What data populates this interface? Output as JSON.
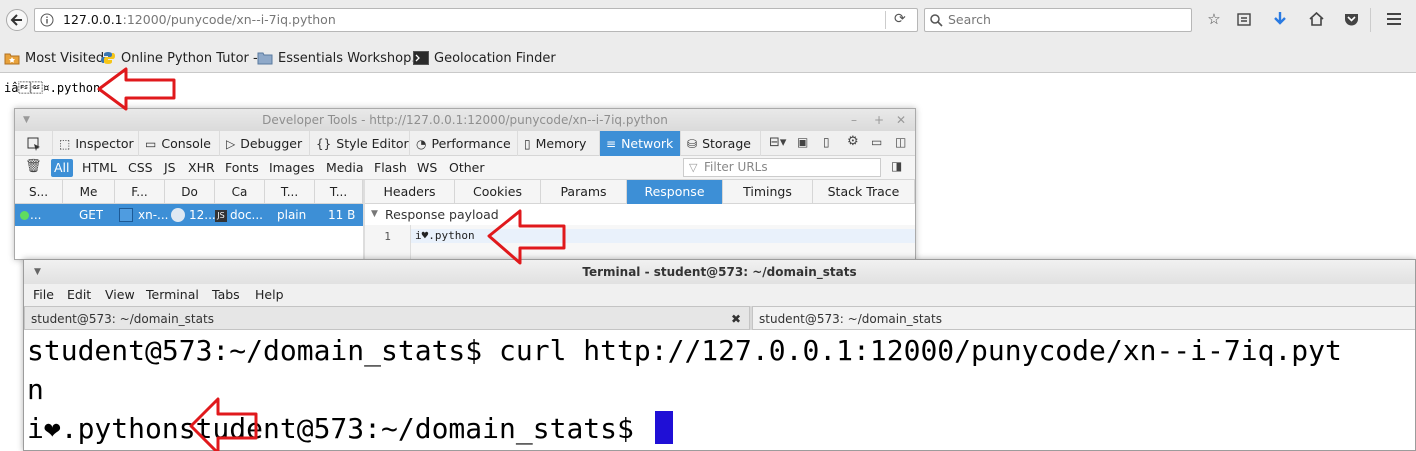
{
  "browser": {
    "url": "127.0.0.1:12000/punycode/xn--i-7iq.python",
    "url_host": "127.0.0.1",
    "url_rest": ":12000/punycode/xn--i-7iq.python",
    "search_placeholder": "Search",
    "bookmarks": [
      {
        "label": "Most Visited",
        "icon": "star-folder-icon"
      },
      {
        "label": "Online Python Tutor -...",
        "icon": "python-icon"
      },
      {
        "label": "Essentials Workshop...",
        "icon": "folder-icon"
      },
      {
        "label": "Geolocation Finder",
        "icon": "terminal-icon"
      }
    ],
    "page_text": "iâ\u001c\u001d¤.python"
  },
  "devtools": {
    "title": "Developer Tools - http://127.0.0.1:12000/punycode/xn--i-7iq.python",
    "tabs": [
      {
        "label": "Inspector",
        "icon": "inspector-icon"
      },
      {
        "label": "Console",
        "icon": "console-icon"
      },
      {
        "label": "Debugger",
        "icon": "debugger-icon"
      },
      {
        "label": "Style Editor",
        "icon": "style-editor-icon"
      },
      {
        "label": "Performance",
        "icon": "performance-icon"
      },
      {
        "label": "Memory",
        "icon": "memory-icon"
      },
      {
        "label": "Network",
        "icon": "network-icon",
        "active": true
      },
      {
        "label": "Storage",
        "icon": "storage-icon"
      }
    ],
    "filters": [
      "All",
      "HTML",
      "CSS",
      "JS",
      "XHR",
      "Fonts",
      "Images",
      "Media",
      "Flash",
      "WS",
      "Other"
    ],
    "filter_placeholder": "Filter URLs",
    "columns": [
      "S...",
      "Me",
      "F...",
      "Do",
      "Ca",
      "T...",
      "T..."
    ],
    "request": {
      "status": "...",
      "method": "GET",
      "file": "xn-...",
      "domain": "12...",
      "cause": "doc...",
      "type": "plain",
      "transferred": "11 B"
    },
    "detail_tabs": [
      "Headers",
      "Cookies",
      "Params",
      "Response",
      "Timings",
      "Stack Trace"
    ],
    "active_detail_tab": "Response",
    "payload_label": "Response payload",
    "line_number": "1",
    "payload_text": "i♥.python"
  },
  "terminal": {
    "title": "Terminal - student@573: ~/domain_stats",
    "menu": [
      "File",
      "Edit",
      "View",
      "Terminal",
      "Tabs",
      "Help"
    ],
    "tabs": [
      "student@573: ~/domain_stats",
      "student@573: ~/domain_stats"
    ],
    "close_glyph": "✖",
    "lines": [
      "student@573:~/domain_stats$ curl http://127.0.0.1:12000/punycode/xn--i-7iq.pyt",
      "n",
      "i❤.pythonstudent@573:~/domain_stats$ "
    ]
  },
  "colors": {
    "accent": "#3d8fd6",
    "cursor": "#1f0fd6",
    "annotation_arrow": "#e0191c"
  }
}
